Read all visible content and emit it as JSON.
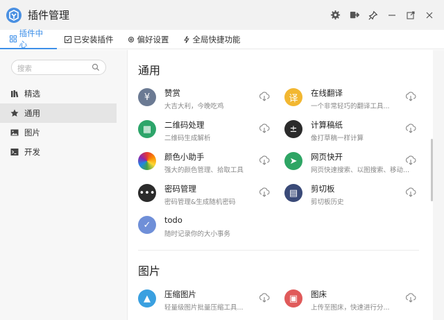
{
  "window": {
    "title": "插件管理",
    "controls": [
      "settings-icon",
      "exit-icon",
      "pin-icon",
      "minimize-icon",
      "detach-icon",
      "close-icon"
    ]
  },
  "tabs": [
    {
      "label": "插件中心",
      "icon": "grid-icon",
      "active": true
    },
    {
      "label": "已安装插件",
      "icon": "checkbox-icon",
      "active": false
    },
    {
      "label": "偏好设置",
      "icon": "gear-icon",
      "active": false
    },
    {
      "label": "全局快捷功能",
      "icon": "bolt-icon",
      "active": false
    }
  ],
  "sidebar": {
    "search_placeholder": "搜索",
    "items": [
      {
        "label": "精选",
        "icon": "bookshelf-icon",
        "active": false
      },
      {
        "label": "通用",
        "icon": "star-icon",
        "active": true
      },
      {
        "label": "图片",
        "icon": "image-icon",
        "active": false
      },
      {
        "label": "开发",
        "icon": "terminal-icon",
        "active": false
      }
    ]
  },
  "sections": [
    {
      "title": "通用",
      "plugins": [
        {
          "name": "赞赏",
          "desc": "大吉大利，今晚吃鸡",
          "color": "#6b7a93",
          "glyph": "¥"
        },
        {
          "name": "在线翻译",
          "desc": "一个非常轻巧的翻译工具...",
          "color": "#f2b731",
          "glyph": "译"
        },
        {
          "name": "二维码处理",
          "desc": "二维码生成解析",
          "color": "#2da56a",
          "glyph": "▦"
        },
        {
          "name": "计算稿纸",
          "desc": "像打草稿一样计算",
          "color": "#2b2b2b",
          "glyph": "±"
        },
        {
          "name": "颜色小助手",
          "desc": "强大的颜色管理、拾取工具",
          "color": "#e0433a",
          "glyph": ""
        },
        {
          "name": "网页快开",
          "desc": "网页快速搜索、以图搜索、移动...",
          "color": "#2ea564",
          "glyph": "➤"
        },
        {
          "name": "密码管理",
          "desc": "密码管理&生成随机密码",
          "color": "#2b2b2b",
          "glyph": "•••"
        },
        {
          "name": "剪切板",
          "desc": "剪切板历史",
          "color": "#3a4a78",
          "glyph": "▤"
        },
        {
          "name": "todo",
          "desc": "随时记录你的大小事务",
          "color": "#6f8fd8",
          "glyph": "✓"
        }
      ]
    },
    {
      "title": "图片",
      "plugins": [
        {
          "name": "压缩图片",
          "desc": "轻量级图片批量压缩工具...",
          "color": "#3aa0e0",
          "glyph": "▲"
        },
        {
          "name": "图床",
          "desc": "上传至图床，快速进行分...",
          "color": "#e05a5a",
          "glyph": "▣"
        }
      ]
    }
  ]
}
